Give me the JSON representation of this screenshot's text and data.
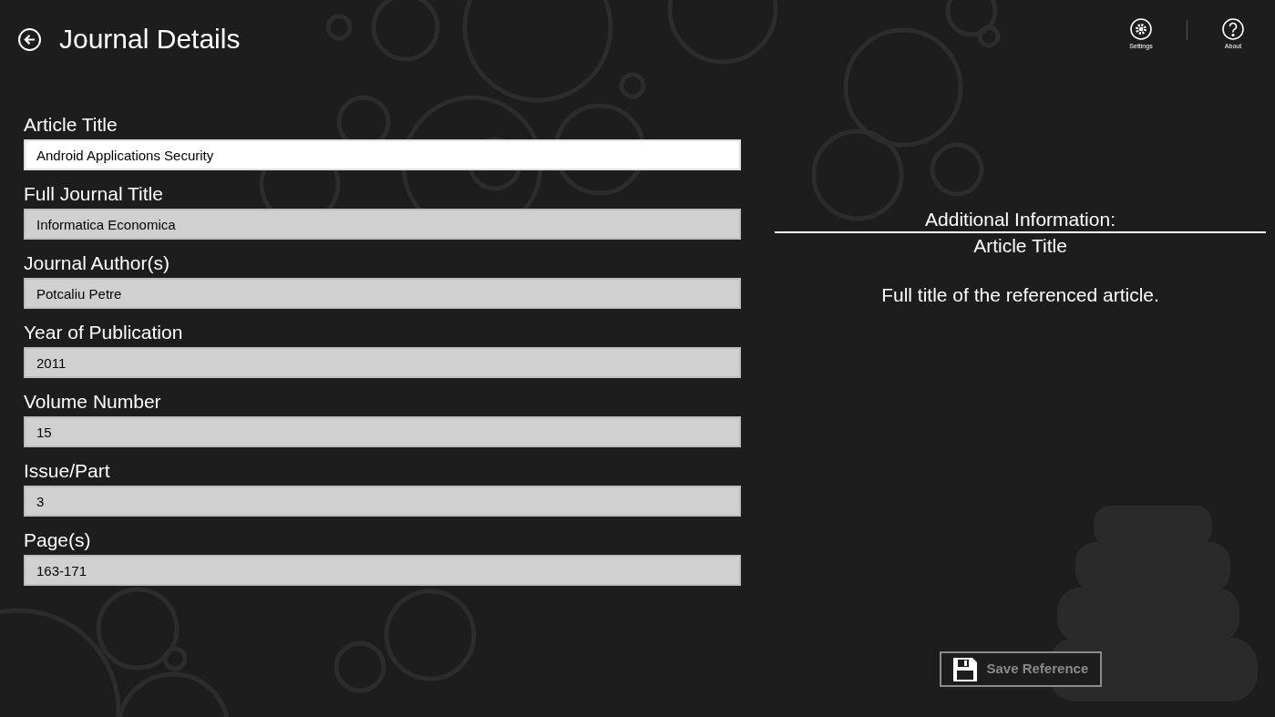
{
  "header": {
    "title": "Journal Details"
  },
  "appbar": [
    {
      "kind": "settings",
      "label": "Settings"
    },
    {
      "kind": "about",
      "label": "About"
    }
  ],
  "fields": [
    {
      "label": "Article Title",
      "value": "Android Applications Security",
      "focused": true
    },
    {
      "label": "Full Journal Title",
      "value": "Informatica Economica",
      "focused": false
    },
    {
      "label": "Journal Author(s)",
      "value": "Potcaliu Petre",
      "focused": false
    },
    {
      "label": "Year of Publication",
      "value": "2011",
      "focused": false
    },
    {
      "label": "Volume Number",
      "value": "15",
      "focused": false
    },
    {
      "label": "Issue/Part",
      "value": "3",
      "focused": false
    },
    {
      "label": "Page(s)",
      "value": "163-171",
      "focused": false
    }
  ],
  "info": {
    "heading": "Additional Information:",
    "subheading": "Article Title",
    "description": "Full title of the referenced article."
  },
  "save_button": {
    "label": "Save Reference",
    "disabled": true
  }
}
